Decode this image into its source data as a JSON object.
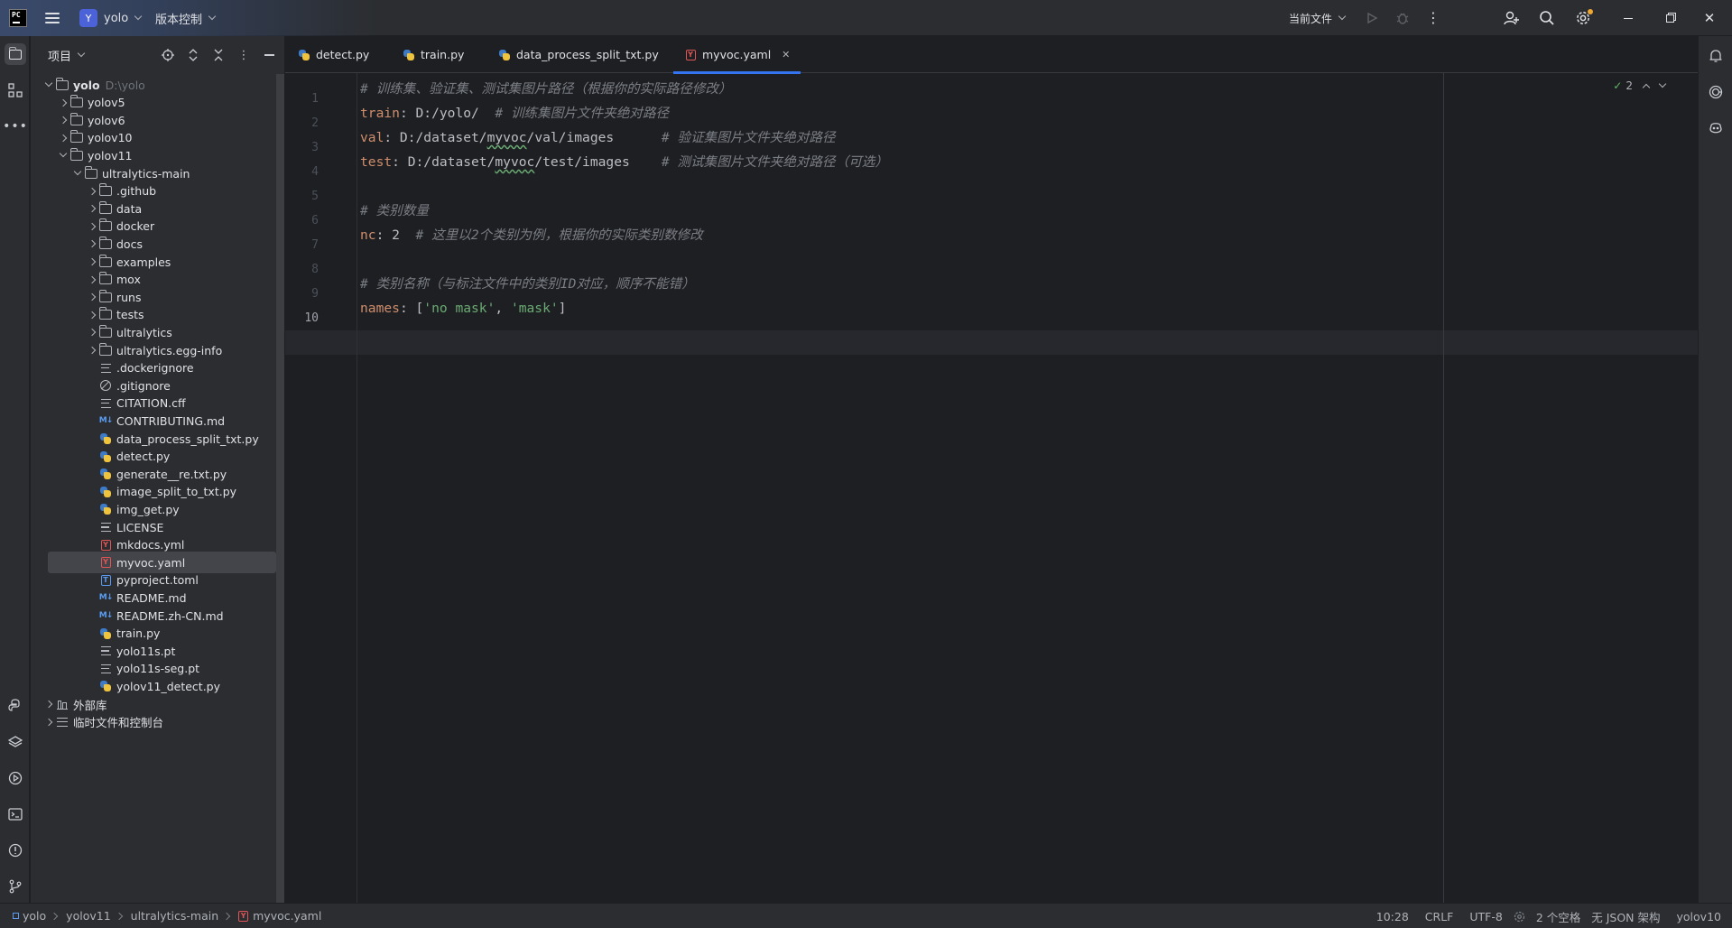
{
  "titlebar": {
    "logo_text": "PC",
    "project_badge": "Y",
    "project_name": "yolo",
    "vcs_label": "版本控制",
    "run_config": "当前文件"
  },
  "project_panel": {
    "title": "项目",
    "tree": [
      {
        "label": "yolo",
        "hint": "D:\\yolo",
        "type": "folder",
        "level": 0,
        "expanded": true,
        "bold": true
      },
      {
        "label": "yolov5",
        "type": "folder",
        "level": 1,
        "expanded": false
      },
      {
        "label": "yolov6",
        "type": "folder",
        "level": 1,
        "expanded": false
      },
      {
        "label": "yolov10",
        "type": "folder",
        "level": 1,
        "expanded": false
      },
      {
        "label": "yolov11",
        "type": "folder",
        "level": 1,
        "expanded": true
      },
      {
        "label": "ultralytics-main",
        "type": "folder",
        "level": 2,
        "expanded": true
      },
      {
        "label": ".github",
        "type": "folder",
        "level": 3,
        "expanded": false
      },
      {
        "label": "data",
        "type": "folder",
        "level": 3,
        "expanded": false
      },
      {
        "label": "docker",
        "type": "folder",
        "level": 3,
        "expanded": false
      },
      {
        "label": "docs",
        "type": "folder",
        "level": 3,
        "expanded": false
      },
      {
        "label": "examples",
        "type": "folder",
        "level": 3,
        "expanded": false
      },
      {
        "label": "mox",
        "type": "folder",
        "level": 3,
        "expanded": false
      },
      {
        "label": "runs",
        "type": "folder",
        "level": 3,
        "expanded": false
      },
      {
        "label": "tests",
        "type": "folder",
        "level": 3,
        "expanded": false
      },
      {
        "label": "ultralytics",
        "type": "folder",
        "level": 3,
        "expanded": false
      },
      {
        "label": "ultralytics.egg-info",
        "type": "folder",
        "level": 3,
        "expanded": false
      },
      {
        "label": ".dockerignore",
        "type": "text",
        "level": 3
      },
      {
        "label": ".gitignore",
        "type": "ignore",
        "level": 3
      },
      {
        "label": "CITATION.cff",
        "type": "text",
        "level": 3
      },
      {
        "label": "CONTRIBUTING.md",
        "type": "md",
        "level": 3
      },
      {
        "label": "data_process_split_txt.py",
        "type": "py",
        "level": 3
      },
      {
        "label": "detect.py",
        "type": "py",
        "level": 3
      },
      {
        "label": "generate__re.txt.py",
        "type": "py",
        "level": 3
      },
      {
        "label": "image_split_to_txt.py",
        "type": "py",
        "level": 3
      },
      {
        "label": "img_get.py",
        "type": "py",
        "level": 3
      },
      {
        "label": "LICENSE",
        "type": "text",
        "level": 3
      },
      {
        "label": "mkdocs.yml",
        "type": "yaml",
        "level": 3
      },
      {
        "label": "myvoc.yaml",
        "type": "yaml",
        "level": 3,
        "selected": true
      },
      {
        "label": "pyproject.toml",
        "type": "toml",
        "level": 3
      },
      {
        "label": "README.md",
        "type": "md",
        "level": 3
      },
      {
        "label": "README.zh-CN.md",
        "type": "md",
        "level": 3
      },
      {
        "label": "train.py",
        "type": "py",
        "level": 3
      },
      {
        "label": "yolo11s.pt",
        "type": "text",
        "level": 3
      },
      {
        "label": "yolo11s-seg.pt",
        "type": "text",
        "level": 3
      },
      {
        "label": "yolov11_detect.py",
        "type": "py",
        "level": 3
      },
      {
        "label": "外部库",
        "type": "lib",
        "level": 0,
        "expanded": false
      },
      {
        "label": "临时文件和控制台",
        "type": "scratch",
        "level": 0,
        "expanded": false
      }
    ]
  },
  "editor": {
    "tabs": [
      {
        "label": "detect.py",
        "type": "py"
      },
      {
        "label": "train.py",
        "type": "py"
      },
      {
        "label": "data_process_split_txt.py",
        "type": "py"
      },
      {
        "label": "myvoc.yaml",
        "type": "yaml",
        "active": true
      }
    ],
    "inspection_count": "2",
    "current_line": 10,
    "lines": [
      [
        {
          "t": "# 训练集、验证集、测试集图片路径（根据你的实际路径修改）",
          "c": "c"
        }
      ],
      [
        {
          "t": "train",
          "c": "k"
        },
        {
          "t": ": D:/yolo/  ",
          "c": "p"
        },
        {
          "t": "# 训练集图片文件夹绝对路径",
          "c": "c"
        }
      ],
      [
        {
          "t": "val",
          "c": "k"
        },
        {
          "t": ": D:/dataset/",
          "c": "p"
        },
        {
          "t": "myvoc",
          "c": "p u"
        },
        {
          "t": "/val/images      ",
          "c": "p"
        },
        {
          "t": "# 验证集图片文件夹绝对路径",
          "c": "c"
        }
      ],
      [
        {
          "t": "test",
          "c": "k"
        },
        {
          "t": ": D:/dataset/",
          "c": "p"
        },
        {
          "t": "myvoc",
          "c": "p u"
        },
        {
          "t": "/test/images    ",
          "c": "p"
        },
        {
          "t": "# 测试集图片文件夹绝对路径（可选）",
          "c": "c"
        }
      ],
      [],
      [
        {
          "t": "# 类别数量",
          "c": "c"
        }
      ],
      [
        {
          "t": "nc",
          "c": "k"
        },
        {
          "t": ": 2  ",
          "c": "p"
        },
        {
          "t": "# 这里以2个类别为例，根据你的实际类别数修改",
          "c": "c"
        }
      ],
      [],
      [
        {
          "t": "# 类别名称（与标注文件中的类别ID对应，顺序不能错）",
          "c": "c"
        }
      ],
      [
        {
          "t": "names",
          "c": "k"
        },
        {
          "t": ": [",
          "c": "p"
        },
        {
          "t": "'no mask'",
          "c": "s"
        },
        {
          "t": ", ",
          "c": "p"
        },
        {
          "t": "'mask'",
          "c": "s"
        },
        {
          "t": "]",
          "c": "p"
        }
      ]
    ]
  },
  "statusbar": {
    "breadcrumbs": [
      "yolo",
      "yolov11",
      "ultralytics-main",
      "myvoc.yaml"
    ],
    "position": "10:28",
    "line_ending": "CRLF",
    "encoding": "UTF-8",
    "indent": "2 个空格",
    "schema": "无 JSON 架构",
    "interpreter": "yolov10"
  },
  "colors": {
    "accent": "#3574f0",
    "background": "#1e1f22",
    "panel": "#2b2d30",
    "keyword": "#cf8e6d",
    "comment": "#7a7e85",
    "string": "#6aab73"
  }
}
